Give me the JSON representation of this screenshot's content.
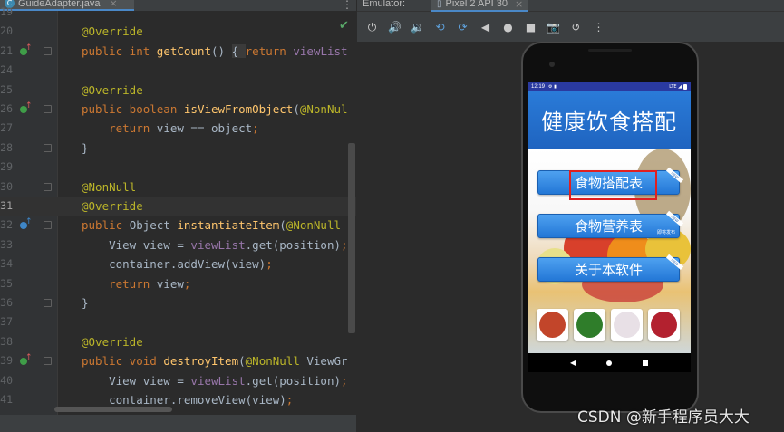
{
  "editor": {
    "file_tab": {
      "icon": "C",
      "name": "GuideAdapter.java",
      "close": "×"
    },
    "menu_glyph": "⋮",
    "lines": [
      {
        "num": "19",
        "tokens": []
      },
      {
        "num": "20",
        "tokens": [
          {
            "c": "t-an",
            "t": "@Override"
          }
        ]
      },
      {
        "num": "21",
        "mark": "override",
        "fold": true,
        "tokens": [
          {
            "c": "t-kw",
            "t": "public int "
          },
          {
            "c": "t-fn",
            "t": "getCount"
          },
          {
            "c": "t-pl",
            "t": "() "
          },
          {
            "c": "t-hint",
            "t": "{ "
          },
          {
            "c": "t-kw",
            "t": "return "
          },
          {
            "c": "t-fld",
            "t": "viewList"
          }
        ]
      },
      {
        "num": "24",
        "tokens": []
      },
      {
        "num": "25",
        "tokens": [
          {
            "c": "t-an",
            "t": "@Override"
          }
        ]
      },
      {
        "num": "26",
        "mark": "override",
        "fold": true,
        "tokens": [
          {
            "c": "t-kw",
            "t": "public boolean "
          },
          {
            "c": "t-fn",
            "t": "isViewFromObject"
          },
          {
            "c": "t-pl",
            "t": "("
          },
          {
            "c": "t-an",
            "t": "@NonNul"
          }
        ]
      },
      {
        "num": "27",
        "tokens": [
          {
            "c": "t-pl",
            "t": "    "
          },
          {
            "c": "t-kw",
            "t": "return "
          },
          {
            "c": "t-pl",
            "t": "view == object"
          },
          {
            "c": "t-kw",
            "t": ";"
          }
        ]
      },
      {
        "num": "28",
        "fold": true,
        "tokens": [
          {
            "c": "t-pl",
            "t": "}"
          }
        ]
      },
      {
        "num": "29",
        "tokens": []
      },
      {
        "num": "30",
        "fold": true,
        "tokens": [
          {
            "c": "t-an",
            "t": "@NonNull"
          }
        ]
      },
      {
        "num": "31",
        "current": true,
        "tokens": [
          {
            "c": "t-an",
            "t": "@Override"
          }
        ]
      },
      {
        "num": "32",
        "mark": "implement",
        "fold": true,
        "tokens": [
          {
            "c": "t-kw",
            "t": "public "
          },
          {
            "c": "t-pl",
            "t": "Object "
          },
          {
            "c": "t-fn",
            "t": "instantiateItem"
          },
          {
            "c": "t-pl",
            "t": "("
          },
          {
            "c": "t-an",
            "t": "@NonNull"
          }
        ]
      },
      {
        "num": "33",
        "tokens": [
          {
            "c": "t-pl",
            "t": "    View view = "
          },
          {
            "c": "t-fld",
            "t": "viewList"
          },
          {
            "c": "t-pl",
            "t": ".get(position)"
          },
          {
            "c": "t-kw",
            "t": ";"
          }
        ]
      },
      {
        "num": "34",
        "tokens": [
          {
            "c": "t-pl",
            "t": "    container.addView(view)"
          },
          {
            "c": "t-kw",
            "t": ";"
          }
        ]
      },
      {
        "num": "35",
        "tokens": [
          {
            "c": "t-pl",
            "t": "    "
          },
          {
            "c": "t-kw",
            "t": "return "
          },
          {
            "c": "t-pl",
            "t": "view"
          },
          {
            "c": "t-kw",
            "t": ";"
          }
        ]
      },
      {
        "num": "36",
        "fold": true,
        "tokens": [
          {
            "c": "t-pl",
            "t": "}"
          }
        ]
      },
      {
        "num": "37",
        "tokens": []
      },
      {
        "num": "38",
        "tokens": [
          {
            "c": "t-an",
            "t": "@Override"
          }
        ]
      },
      {
        "num": "39",
        "mark": "override",
        "fold": true,
        "tokens": [
          {
            "c": "t-kw",
            "t": "public void "
          },
          {
            "c": "t-fn",
            "t": "destroyItem"
          },
          {
            "c": "t-pl",
            "t": "("
          },
          {
            "c": "t-an",
            "t": "@NonNull "
          },
          {
            "c": "t-pl",
            "t": "ViewGr"
          }
        ]
      },
      {
        "num": "40",
        "tokens": [
          {
            "c": "t-pl",
            "t": "    View view = "
          },
          {
            "c": "t-fld",
            "t": "viewList"
          },
          {
            "c": "t-pl",
            "t": ".get(position)"
          },
          {
            "c": "t-kw",
            "t": ";"
          }
        ]
      },
      {
        "num": "41",
        "tokens": [
          {
            "c": "t-pl",
            "t": "    container.removeView(view)"
          },
          {
            "c": "t-kw",
            "t": ";"
          }
        ]
      }
    ],
    "status_check": "✔"
  },
  "emulator": {
    "label": "Emulator:",
    "device_tab": {
      "name": "Pixel 2 API 30",
      "close": "×"
    },
    "toolbar": [
      {
        "name": "power-icon",
        "glyph": "⏻"
      },
      {
        "name": "volume-up-icon",
        "glyph": "🔊"
      },
      {
        "name": "volume-down-icon",
        "glyph": "🔉"
      },
      {
        "name": "rotate-left-icon",
        "glyph": "⟲"
      },
      {
        "name": "rotate-right-icon",
        "glyph": "⟳"
      },
      {
        "name": "back-icon",
        "glyph": "◀"
      },
      {
        "name": "home-icon",
        "glyph": "●"
      },
      {
        "name": "overview-icon",
        "glyph": "■"
      },
      {
        "name": "screenshot-icon",
        "glyph": "📷"
      },
      {
        "name": "snapshot-icon",
        "glyph": "↺"
      },
      {
        "name": "more-icon",
        "glyph": "⋮"
      }
    ]
  },
  "phone": {
    "status": {
      "time": "12:19",
      "icons": "⚙ ▮",
      "network": "LTE ◢"
    },
    "app_title": "健康饮食搭配",
    "buttons": [
      {
        "label": "食物搭配表",
        "ribbon": "NEW",
        "tag": ""
      },
      {
        "label": "食物营养表",
        "ribbon": "NEW",
        "tag": "即将发布"
      },
      {
        "label": "关于本软件",
        "ribbon": "NEW",
        "tag": ""
      }
    ],
    "thumbnails": [
      {
        "name": "thumb-crab",
        "color": "#c2452a"
      },
      {
        "name": "thumb-spinach",
        "color": "#2f7d2a"
      },
      {
        "name": "thumb-garlic",
        "color": "#e8e0e6"
      },
      {
        "name": "thumb-meat",
        "color": "#b3212f"
      }
    ],
    "nav": {
      "back": "◀"
    }
  },
  "watermark": "CSDN @新手程序员大大"
}
